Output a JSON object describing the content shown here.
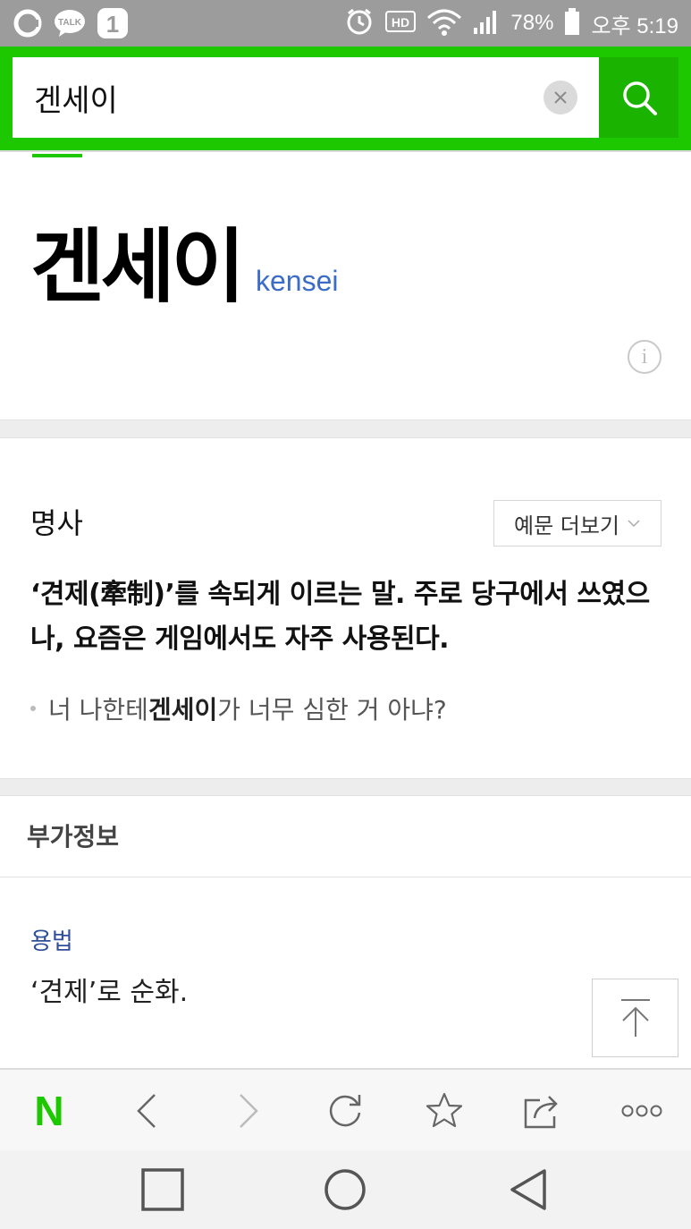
{
  "status_bar": {
    "battery_percent": "78%",
    "time": "오후 5:19",
    "icons": [
      "g-icon",
      "talk-icon",
      "one-icon",
      "alarm-icon",
      "hd-icon",
      "wifi-icon",
      "signal-icon",
      "battery-icon"
    ],
    "talk_label": "TALK",
    "one_label": "1",
    "hd_label": "HD"
  },
  "search": {
    "query": "겐세이",
    "accent_color": "#1ec800"
  },
  "entry": {
    "headword": "겐세이",
    "pronunciation": "kensei",
    "info_label": "i"
  },
  "definition": {
    "part_of_speech": "명사",
    "more_examples_label": "예문 더보기",
    "text": "‘견제(牽制)’를 속되게 이르는 말. 주로 당구에서 쓰였으나, 요즘은 게임에서도 자주 사용된다.",
    "example_before": "너 나한테 ",
    "example_highlight": "겐세이",
    "example_after": "가 너무 심한 거 아냐?"
  },
  "extra_info": {
    "title": "부가정보",
    "usage_label": "용법",
    "usage_text": "‘견제’로 순화."
  },
  "browser_toolbar": {
    "logo": "N",
    "items": [
      "back-icon",
      "forward-icon",
      "refresh-icon",
      "bookmark-star-icon",
      "share-icon",
      "more-icon"
    ]
  },
  "nav_bar": {
    "items": [
      "recent-apps-icon",
      "home-icon",
      "back-icon"
    ]
  }
}
